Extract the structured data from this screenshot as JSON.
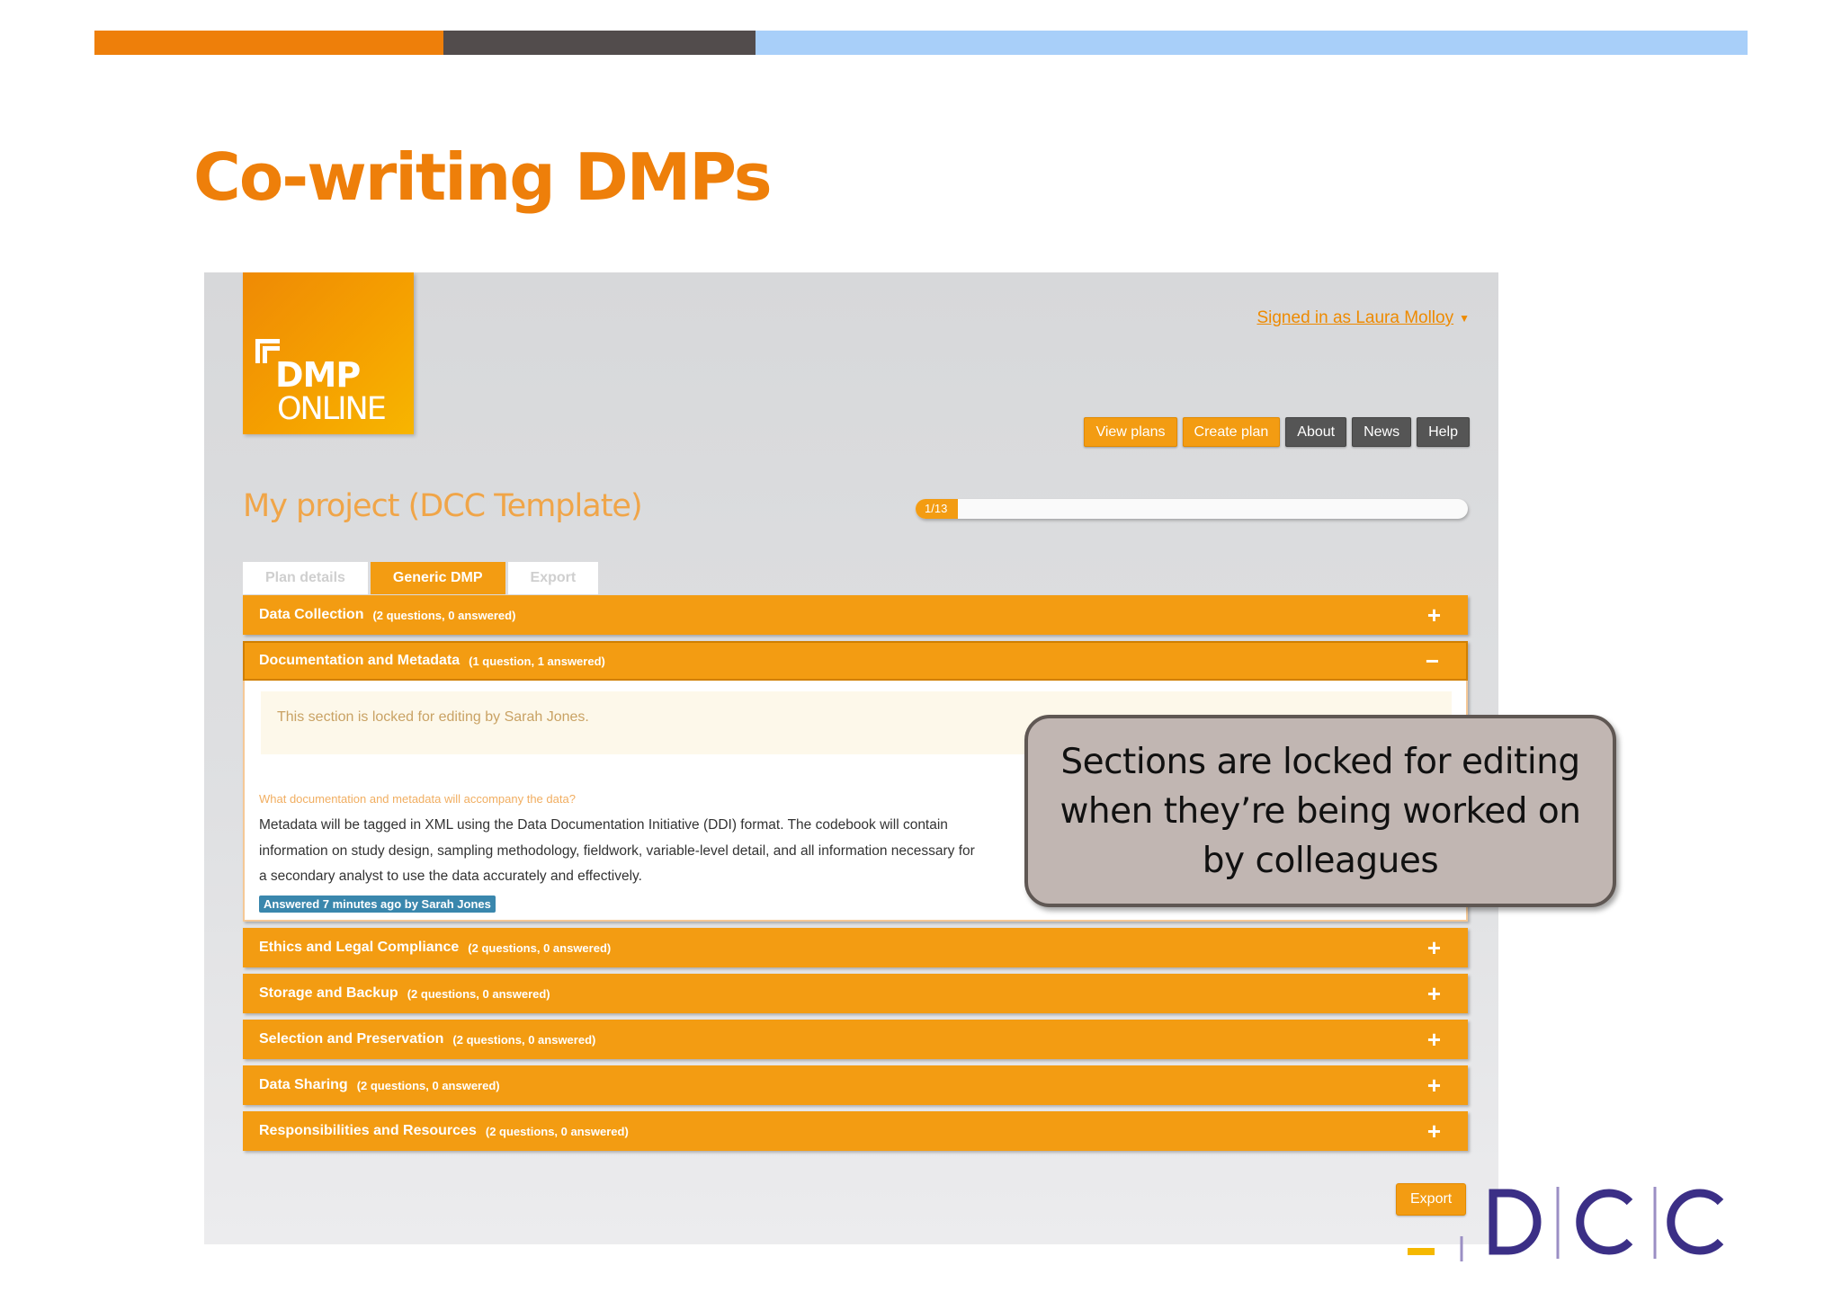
{
  "slide": {
    "title": "Co-writing DMPs",
    "colors": {
      "orange": "#ee7f0a",
      "dark": "#524c4c",
      "light_blue": "#a8cff9"
    }
  },
  "app": {
    "logo": {
      "line1": "DMP",
      "line2": "ONLINE"
    },
    "signed_in": "Signed in as Laura Molloy",
    "nav": [
      "View plans",
      "Create plan",
      "About",
      "News",
      "Help"
    ],
    "project_title": "My project (DCC Template)",
    "progress": {
      "label": "1/13",
      "fraction": 0.0769
    },
    "tabs": [
      "Plan details",
      "Generic DMP",
      "Export"
    ],
    "active_tab": "Generic DMP",
    "sections_before": [
      {
        "title": "Data Collection",
        "count": "(2 questions, 0 answered)",
        "toggle": "+"
      }
    ],
    "open_section": {
      "title": "Documentation and Metadata",
      "count": "(1 question, 1 answered)",
      "toggle": "−",
      "lock_notice": "This section is locked for editing by Sarah Jones.",
      "question": "What documentation and metadata will accompany the data?",
      "answer": "Metadata will be tagged in XML using the Data Documentation Initiative (DDI) format. The codebook will contain information on study design, sampling methodology, fieldwork, variable-level detail, and all information necessary for a secondary analyst to use the data accurately and effectively.",
      "answered_badge": "Answered 7 minutes ago by Sarah Jones"
    },
    "sections_after": [
      {
        "title": "Ethics and Legal Compliance",
        "count": "(2 questions, 0 answered)",
        "toggle": "+"
      },
      {
        "title": "Storage and Backup",
        "count": "(2 questions, 0 answered)",
        "toggle": "+"
      },
      {
        "title": "Selection and Preservation",
        "count": "(2 questions, 0 answered)",
        "toggle": "+"
      },
      {
        "title": "Data Sharing",
        "count": "(2 questions, 0 answered)",
        "toggle": "+"
      },
      {
        "title": "Responsibilities and Resources",
        "count": "(2 questions, 0 answered)",
        "toggle": "+"
      }
    ],
    "export_button": "Export",
    "accent_color": "#f39c12"
  },
  "callout": {
    "text": "Sections are locked for editing when they’re being worked on by colleagues"
  },
  "footer_logo": {
    "text": "DCC"
  }
}
